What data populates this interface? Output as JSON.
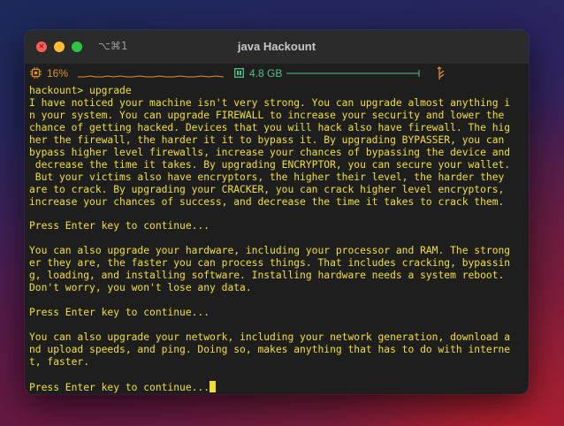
{
  "window": {
    "shortcut": "⌥⌘1",
    "title": "java Hackount"
  },
  "status": {
    "cpu_label": "16%",
    "cpu_percent": 16,
    "memory_label": "4.8 GB",
    "cpu_color": "#e0922a",
    "memory_color": "#4fc08d",
    "network_color": "#e0922a"
  },
  "icons": {
    "cpu": "cpu-chip-icon",
    "memory": "memory-icon",
    "network": "network-arrows-icon",
    "close": "close-icon",
    "minimize": "minimize-icon",
    "maximize": "maximize-icon"
  },
  "terminal": {
    "text_color": "#f0e02a",
    "lines": [
      "hackount> upgrade",
      "I have noticed your machine isn't very strong. You can upgrade almost anything i",
      "n your system. You can upgrade FIREWALL to increase your security and lower the",
      "chance of getting hacked. Devices that you will hack also have firewall. The hig",
      "her the firewall, the harder it it to bypass it. By upgrading BYPASSER, you can",
      "bypass higher level firewalls, increase your chances of bypassing the device and",
      " decrease the time it takes. By upgrading ENCRYPTOR, you can secure your wallet.",
      " But your victims also have encryptors, the higher their level, the harder they",
      "are to crack. By upgrading your CRACKER, you can crack higher level encryptors,",
      "increase your chances of success, and decrease the time it takes to crack them.",
      "",
      "Press Enter key to continue...",
      "",
      "You can also upgrade your hardware, including your processor and RAM. The strong",
      "er they are, the faster you can process things. That includes cracking, bypassin",
      "g, loading, and installing software. Installing hardware needs a system reboot.",
      "Don't worry, you won't lose any data.",
      "",
      "Press Enter key to continue...",
      "",
      "You can also upgrade your network, including your network generation, download a",
      "nd upload speeds, and ping. Doing so, makes anything that has to do with interne",
      "t, faster.",
      "",
      "Press Enter key to continue..."
    ]
  }
}
